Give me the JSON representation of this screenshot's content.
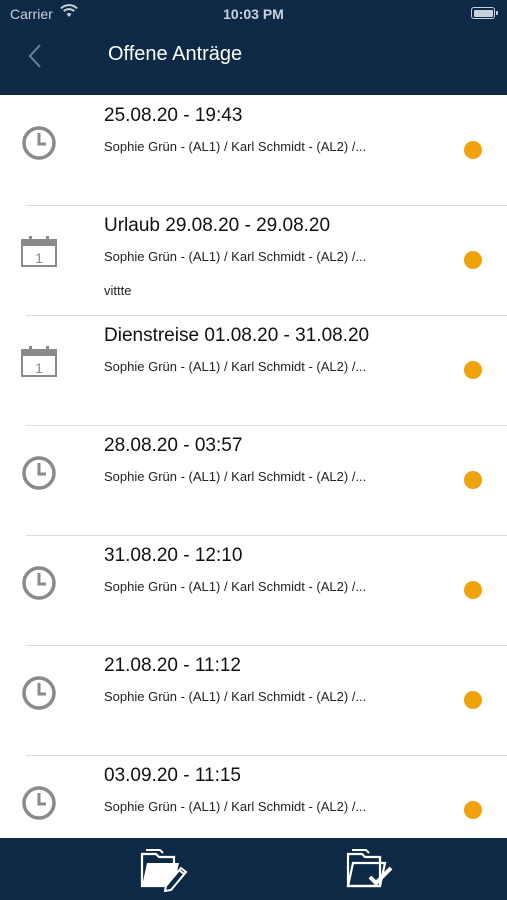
{
  "status": {
    "carrier": "Carrier",
    "time": "10:03 PM"
  },
  "header": {
    "title": "Offene Anträge"
  },
  "colors": {
    "bar": "#0d2945",
    "pending": "#f0a20a",
    "icon": "#8a8a8a"
  },
  "requests": [
    {
      "icon": "clock-icon",
      "title": "25.08.20 - 19:43",
      "approvers": "Sophie Grün - (AL1) / Karl Schmidt - (AL2) /...",
      "note": ""
    },
    {
      "icon": "calendar-icon",
      "title": "Urlaub 29.08.20 - 29.08.20",
      "approvers": "Sophie Grün - (AL1) / Karl Schmidt - (AL2) /...",
      "note": "vittte"
    },
    {
      "icon": "calendar-icon",
      "title": "Dienstreise 01.08.20 - 31.08.20",
      "approvers": "Sophie Grün - (AL1) / Karl Schmidt - (AL2) /...",
      "note": ""
    },
    {
      "icon": "clock-icon",
      "title": "28.08.20 - 03:57",
      "approvers": "Sophie Grün - (AL1) / Karl Schmidt - (AL2) /...",
      "note": ""
    },
    {
      "icon": "clock-icon",
      "title": "31.08.20 - 12:10",
      "approvers": "Sophie Grün - (AL1) / Karl Schmidt - (AL2) /...",
      "note": ""
    },
    {
      "icon": "clock-icon",
      "title": "21.08.20 - 11:12",
      "approvers": "Sophie Grün - (AL1) / Karl Schmidt - (AL2) /...",
      "note": ""
    },
    {
      "icon": "clock-icon",
      "title": "03.09.20 - 11:15",
      "approvers": "Sophie Grün - (AL1) / Karl Schmidt - (AL2) /...",
      "note": ""
    }
  ],
  "tabs": [
    {
      "icon": "edit-request-icon"
    },
    {
      "icon": "approved-requests-icon"
    }
  ]
}
